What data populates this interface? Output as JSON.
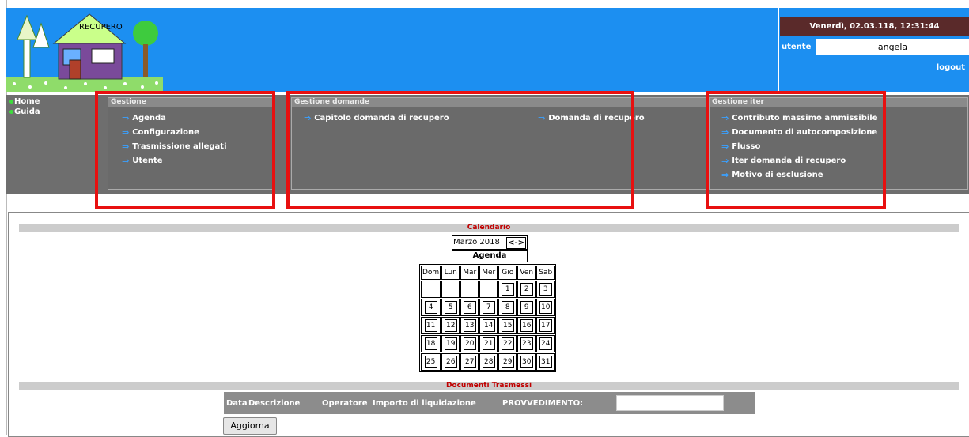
{
  "header": {
    "logo_text": "RECUPERO",
    "datetime": "Venerdì, 02.03.118, 12:31:44",
    "user_label": "utente",
    "user_value": "angela",
    "logout": "logout"
  },
  "sidebar": [
    {
      "label": "Home"
    },
    {
      "label": "Guida"
    }
  ],
  "panels": {
    "gestione": {
      "title": "Gestione",
      "items": [
        "Agenda",
        "Configurazione",
        "Trasmissione allegati",
        "Utente"
      ]
    },
    "domande": {
      "title": "Gestione domande",
      "items": [
        "Capitolo domanda di recupero",
        "Domanda di recupero"
      ]
    },
    "iter": {
      "title": "Gestione iter",
      "items": [
        "Contributo massimo ammissibile",
        "Documento di autocomposizione",
        "Flusso",
        "Iter domanda di recupero",
        "Motivo di esclusione"
      ]
    }
  },
  "calendar": {
    "section_title": "Calendario",
    "month": "Marzo 2018",
    "nav": "<->",
    "agenda": "Agenda",
    "weekdays": [
      "Dom",
      "Lun",
      "Mar",
      "Mer",
      "Gio",
      "Ven",
      "Sab"
    ],
    "weeks": [
      [
        "",
        "",
        "",
        "",
        "1",
        "2",
        "3"
      ],
      [
        "4",
        "5",
        "6",
        "7",
        "8",
        "9",
        "10"
      ],
      [
        "11",
        "12",
        "13",
        "14",
        "15",
        "16",
        "17"
      ],
      [
        "18",
        "19",
        "20",
        "21",
        "22",
        "23",
        "24"
      ],
      [
        "25",
        "26",
        "27",
        "28",
        "29",
        "30",
        "31"
      ]
    ]
  },
  "documents": {
    "section_title": "Documenti Trasmessi",
    "columns": [
      "Data",
      "Descrizione",
      "Operatore",
      "Importo di liquidazione",
      "PROVVEDIMENTO:"
    ],
    "provvedimento_value": "",
    "button": "Aggiorna"
  },
  "colors": {
    "header_bg": "#1c8ff1",
    "nav_bg": "#6e6e6e",
    "highlight": "#e81010",
    "section_title": "#c00000"
  }
}
